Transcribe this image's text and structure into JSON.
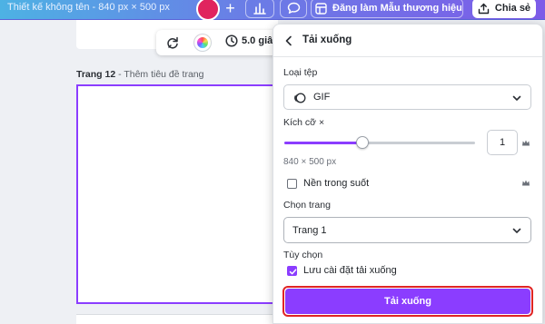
{
  "topbar": {
    "doc_title": "Thiết kế không tên - 840 px × 500 px",
    "plus_label": "+",
    "brand_button_label": "Đăng làm Mẫu thương hiệu",
    "share_button_label": "Chia sẻ",
    "icons": {
      "avatar": "avatar",
      "chart": "chart-icon",
      "comment": "comment-icon",
      "brand": "template-icon",
      "share": "upload-icon"
    }
  },
  "canvas": {
    "toolbar": {
      "time_label": "5.0 giâ"
    },
    "page_number": "Trang 12",
    "page_title_placeholder": " - Thêm tiêu đề trang"
  },
  "download_panel": {
    "title": "Tải xuống",
    "file_type_label": "Loại tệp",
    "file_type_value": "GIF",
    "size_label": "Kích cỡ ×",
    "size_scale_value": "1",
    "size_slider_fraction": 0.41,
    "dimensions_text": "840 × 500 px",
    "transparent_label": "Nền trong suốt",
    "transparent_checked": false,
    "pages_label": "Chọn trang",
    "pages_value": "Trang 1",
    "options_label": "Tùy chọn",
    "save_settings_label": "Lưu cài đặt tải xuống",
    "save_settings_checked": true,
    "download_button_label": "Tải xuống"
  },
  "colors": {
    "accent": "#8b3dff",
    "highlight_border": "#e02424",
    "topbar_gradient_start": "#4db2e4",
    "topbar_gradient_end": "#7d5ce8"
  }
}
